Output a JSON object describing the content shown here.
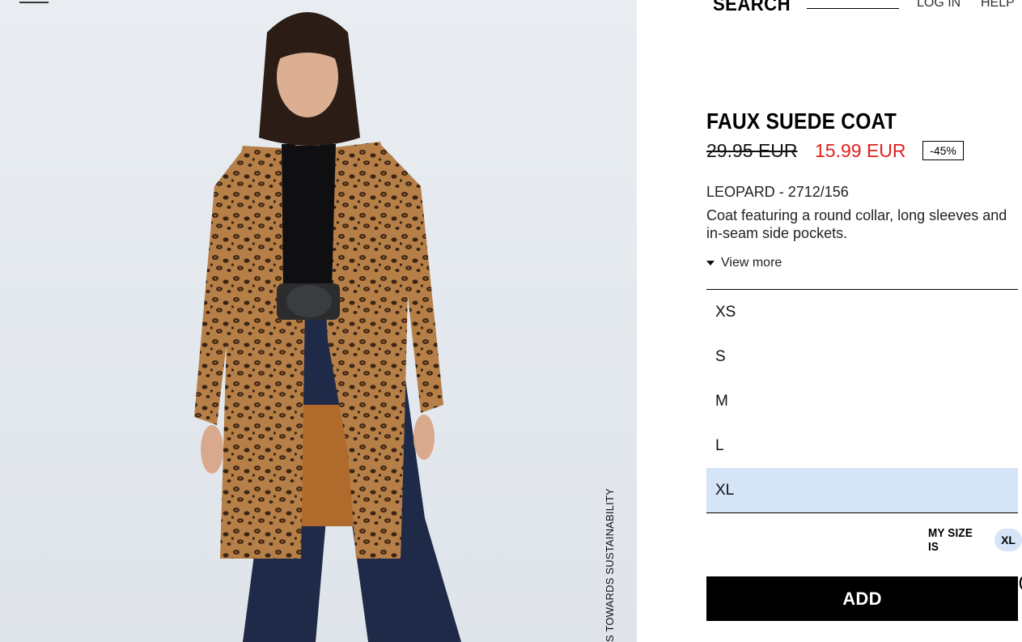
{
  "header": {
    "search_label": "SEARCH",
    "login_label": "LOG IN",
    "help_label": "HELP"
  },
  "image_panel": {
    "vertical_text": "S TOWARDS SUSTAINABILITY"
  },
  "product": {
    "title": "FAUX SUEDE COAT",
    "old_price": "29.95 EUR",
    "new_price": "15.99 EUR",
    "discount": "-45%",
    "color_ref": "LEOPARD - 2712/156",
    "description": "Coat featuring a round collar, long sleeves and in-seam side pockets.",
    "view_more": "View more"
  },
  "sizes": {
    "options": [
      "XS",
      "S",
      "M",
      "L",
      "XL"
    ],
    "selected": "XL"
  },
  "my_size": {
    "label": "MY SIZE IS",
    "value": "XL"
  },
  "add_button": "ADD",
  "edge_mark": "(",
  "colors": {
    "sale_red": "#e0201f",
    "selected_bg": "#d5e4f7",
    "button_bg": "#000000",
    "image_bg": "#e6eaf0"
  },
  "icons": {
    "view_more": "caret-down-icon",
    "menu": "menu-icon"
  }
}
